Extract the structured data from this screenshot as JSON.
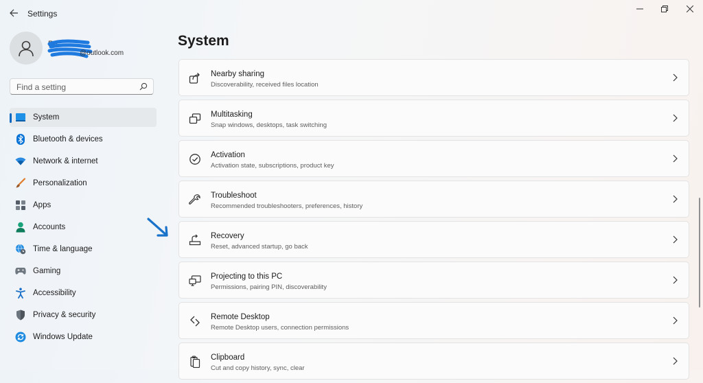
{
  "window": {
    "title": "Settings",
    "controls": [
      "minimize",
      "restore",
      "close"
    ]
  },
  "profile": {
    "name": "Ra",
    "email": "@outlook.com"
  },
  "search": {
    "placeholder": "Find a setting"
  },
  "sidebar": {
    "items": [
      {
        "label": "System",
        "icon": "system-icon",
        "active": true
      },
      {
        "label": "Bluetooth & devices",
        "icon": "bluetooth-icon"
      },
      {
        "label": "Network & internet",
        "icon": "wifi-icon"
      },
      {
        "label": "Personalization",
        "icon": "brush-icon"
      },
      {
        "label": "Apps",
        "icon": "apps-icon"
      },
      {
        "label": "Accounts",
        "icon": "accounts-icon"
      },
      {
        "label": "Time & language",
        "icon": "globe-clock-icon"
      },
      {
        "label": "Gaming",
        "icon": "gamepad-icon"
      },
      {
        "label": "Accessibility",
        "icon": "accessibility-icon"
      },
      {
        "label": "Privacy & security",
        "icon": "shield-icon"
      },
      {
        "label": "Windows Update",
        "icon": "update-icon"
      }
    ]
  },
  "main": {
    "title": "System",
    "cards": [
      {
        "title": "Nearby sharing",
        "subtitle": "Discoverability, received files location",
        "icon": "share-icon"
      },
      {
        "title": "Multitasking",
        "subtitle": "Snap windows, desktops, task switching",
        "icon": "multitasking-icon"
      },
      {
        "title": "Activation",
        "subtitle": "Activation state, subscriptions, product key",
        "icon": "check-circle-icon"
      },
      {
        "title": "Troubleshoot",
        "subtitle": "Recommended troubleshooters, preferences, history",
        "icon": "wrench-icon"
      },
      {
        "title": "Recovery",
        "subtitle": "Reset, advanced startup, go back",
        "icon": "recovery-icon"
      },
      {
        "title": "Projecting to this PC",
        "subtitle": "Permissions, pairing PIN, discoverability",
        "icon": "projecting-icon"
      },
      {
        "title": "Remote Desktop",
        "subtitle": "Remote Desktop users, connection permissions",
        "icon": "remote-desktop-icon"
      },
      {
        "title": "Clipboard",
        "subtitle": "Cut and copy history, sync, clear",
        "icon": "clipboard-icon"
      }
    ]
  },
  "colors": {
    "accent": "#0067c0",
    "arrow_annotation": "#1a73c9"
  }
}
